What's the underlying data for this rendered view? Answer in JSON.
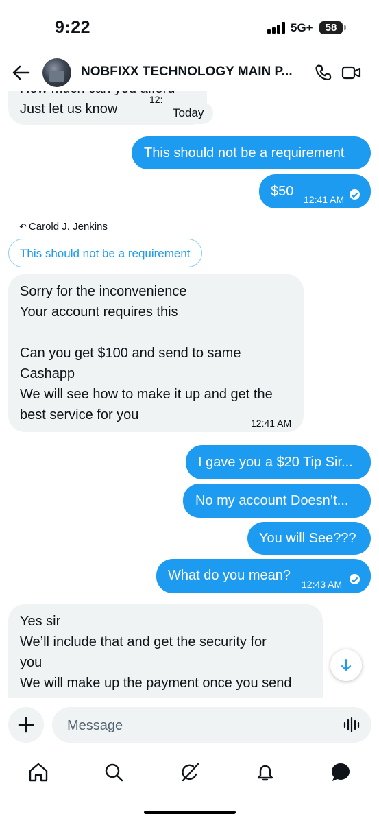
{
  "status": {
    "time": "9:22",
    "network": "5G+",
    "battery": "58"
  },
  "header": {
    "title": "NOBFIXX TECHNOLOGY MAIN P...",
    "icons": [
      "back-arrow-icon",
      "phone-icon",
      "video-icon"
    ]
  },
  "thread": {
    "date_separator": "Today",
    "messages": [
      {
        "dir": "in",
        "text": "How much can you afford\nJust let us know",
        "time": "12:"
      },
      {
        "dir": "out",
        "text": "This should not be a requirement"
      },
      {
        "dir": "out",
        "text": "$50",
        "time": "12:41 AM"
      },
      {
        "dir": "in",
        "reply_to_author": "Carold J. Jenkins",
        "reply_to_text": "This should not be a requirement",
        "text": "Sorry for the inconvenience\nYour account requires this\n\nCan you get $100 and send to same\nCashapp\nWe will see how to make it up and get the\nbest service for you",
        "time": "12:41 AM"
      },
      {
        "dir": "out",
        "text": "I gave you a $20 Tip Sir..."
      },
      {
        "dir": "out",
        "text": "No my account Doesn’t..."
      },
      {
        "dir": "out",
        "text": "You will See???"
      },
      {
        "dir": "out",
        "text": "What do you mean?",
        "time": "12:43 AM"
      },
      {
        "dir": "in",
        "text": "Yes sir\nWe’ll include that and get the security for\nyou\nWe will make up the payment once you send"
      }
    ]
  },
  "composer": {
    "placeholder": "Message"
  },
  "tabs": [
    "home-icon",
    "search-icon",
    "grok-icon",
    "notifications-icon",
    "messages-icon"
  ],
  "colors": {
    "accent": "#1d9bf0",
    "incoming_bubble": "#eff3f4",
    "text": "#0f1419"
  }
}
